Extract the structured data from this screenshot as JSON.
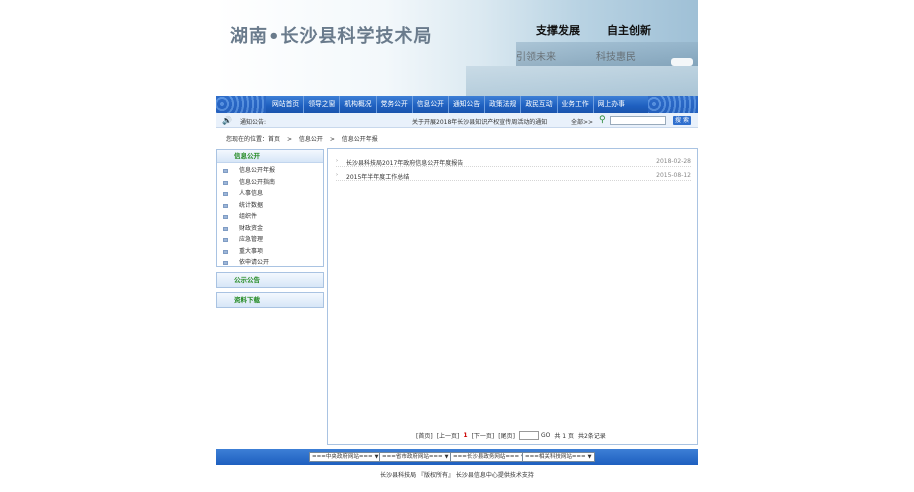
{
  "banner": {
    "title": "湖南•长沙县科学技术局",
    "slogan1": "支撑发展",
    "slogan2": "自主创新",
    "sub1": "引领未来",
    "sub2": "科技惠民"
  },
  "nav": {
    "items": [
      "网站首页",
      "领导之窗",
      "机构概况",
      "党务公开",
      "信息公开",
      "通知公告",
      "政策法规",
      "政民互动",
      "业务工作",
      "网上办事"
    ]
  },
  "notice": {
    "label": "通知公告:",
    "marquee": "关于开展2018年长沙县知识产权宣传周活动的通知",
    "all": "全部>>",
    "search_placeholder": "",
    "search_button": "搜 索"
  },
  "breadcrumb": {
    "prefix": "您现在的位置：首页",
    "sep": ">",
    "level1": "信息公开",
    "level2": "信息公开年报"
  },
  "sidebar": {
    "info_title": "信息公开",
    "info_items": [
      "信息公开年报",
      "信息公开指南",
      "人事信息",
      "统计数据",
      "组织件",
      "财政资金",
      "应急管理",
      "重大事项",
      "依申请公开"
    ],
    "notice_title": "公示公告",
    "download_title": "资料下载"
  },
  "list": {
    "rows": [
      {
        "title": "长沙县科技局2017年政府信息公开年度报告",
        "date": "2018-02-28"
      },
      {
        "title": "2015年半年度工作总结",
        "date": "2015-08-12"
      }
    ]
  },
  "pager": {
    "first": "[首页]",
    "prev": "[上一页]",
    "current": "1",
    "next": "[下一页]",
    "last": "[尾页]",
    "go": "GO",
    "pages": "共 1 页",
    "records": "共2条记录"
  },
  "footer": {
    "selects": [
      "===中央政府网站===",
      "===省市政府网站===",
      "===长沙县政务网站===",
      "===相关科技网站==="
    ],
    "copyright": "长沙县科技局 『版权所有』 长沙县信息中心提供技术支持"
  },
  "colors": {
    "nav_blue": "#1e5fbf",
    "side_title_green": "#238a23"
  }
}
